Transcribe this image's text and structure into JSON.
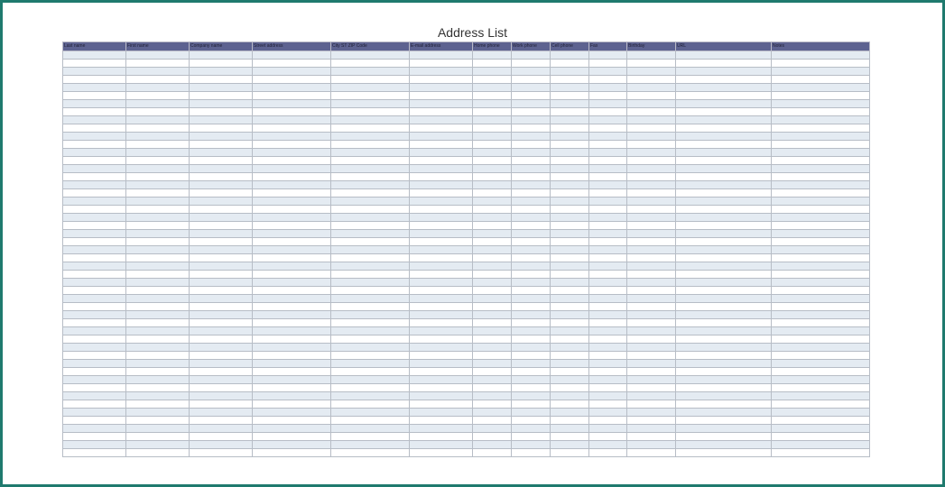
{
  "document": {
    "title": "Address List"
  },
  "table": {
    "columns": [
      "Last name",
      "First name",
      "Company name",
      "Street address",
      "City ST  ZIP Code",
      "E-mail address",
      "Home phone",
      "Work phone",
      "Cell phone",
      "Fax",
      "Birthday",
      "URL",
      "Notes"
    ],
    "visible_blank_rows": 50,
    "row_fill": [
      "white",
      "light blue-gray"
    ]
  },
  "colors": {
    "frame_border": "#1f7a6e",
    "header_background": "#5d6290",
    "header_text": "#1e1e33",
    "row_shade": "#e4ebf2",
    "row_white": "#ffffff",
    "grid_lines": "#b7bdc6",
    "title_text": "#333333"
  }
}
